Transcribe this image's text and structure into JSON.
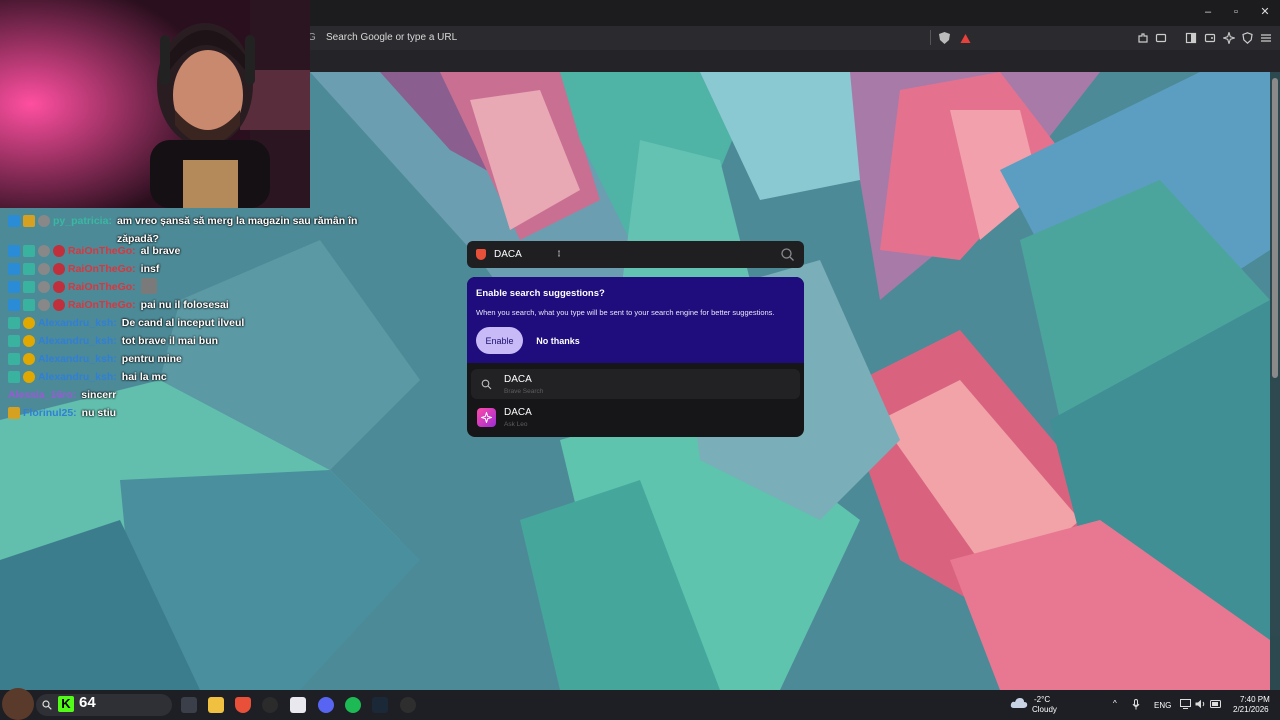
{
  "browser": {
    "url_placeholder": "Search Google or type a URL",
    "window_controls": {
      "minimize": "–",
      "maximize": "▫",
      "close": "✕"
    }
  },
  "search": {
    "value": "DACA",
    "placeholder": ""
  },
  "suggestions_prompt": {
    "title": "Enable search suggestions?",
    "description": "When you search, what you type will be sent to your search engine for better suggestions.",
    "enable_label": "Enable",
    "decline_label": "No thanks"
  },
  "results": [
    {
      "title": "DACA",
      "subtitle": "Brave Search",
      "icon": "search-icon"
    },
    {
      "title": "DACA",
      "subtitle": "Ask Leo",
      "icon": "leo-icon"
    }
  ],
  "chat": {
    "messages": [
      {
        "user": "py_patricia:",
        "color": "#39b8a2",
        "text": "am vreo șansă să merg la magazin sau rămân în zăpadă?"
      },
      {
        "user": "RaiOnTheGo:",
        "color": "#d9363e",
        "text": "al brave"
      },
      {
        "user": "RaiOnTheGo:",
        "color": "#d9363e",
        "text": "insf"
      },
      {
        "user": "RaiOnTheGo:",
        "color": "#d9363e",
        "text": ""
      },
      {
        "user": "RaiOnTheGo:",
        "color": "#d9363e",
        "text": "pai nu il folosesai"
      },
      {
        "user": "Alexandru_ksh:",
        "color": "#2f7fd6",
        "text": "De cand al inceput ilveul"
      },
      {
        "user": "Alexandru_ksh:",
        "color": "#2f7fd6",
        "text": "tot brave il mai bun"
      },
      {
        "user": "Alexandru_ksh:",
        "color": "#2f7fd6",
        "text": "pentru mine"
      },
      {
        "user": "Alexandru_ksh:",
        "color": "#2f7fd6",
        "text": "hai la mc"
      },
      {
        "user": "Alessia_16ro:",
        "color": "#9b59d6",
        "text": "sincerr"
      },
      {
        "user": "Florinul25:",
        "color": "#2f7fd6",
        "text": "nu stiu"
      }
    ]
  },
  "taskbar": {
    "kick_count": "64",
    "kick_letter": "K",
    "weather_temp": "-2°C",
    "weather_desc": "Cloudy",
    "language": "ENG",
    "time": "7:40 PM",
    "date": "2/21/2026"
  }
}
